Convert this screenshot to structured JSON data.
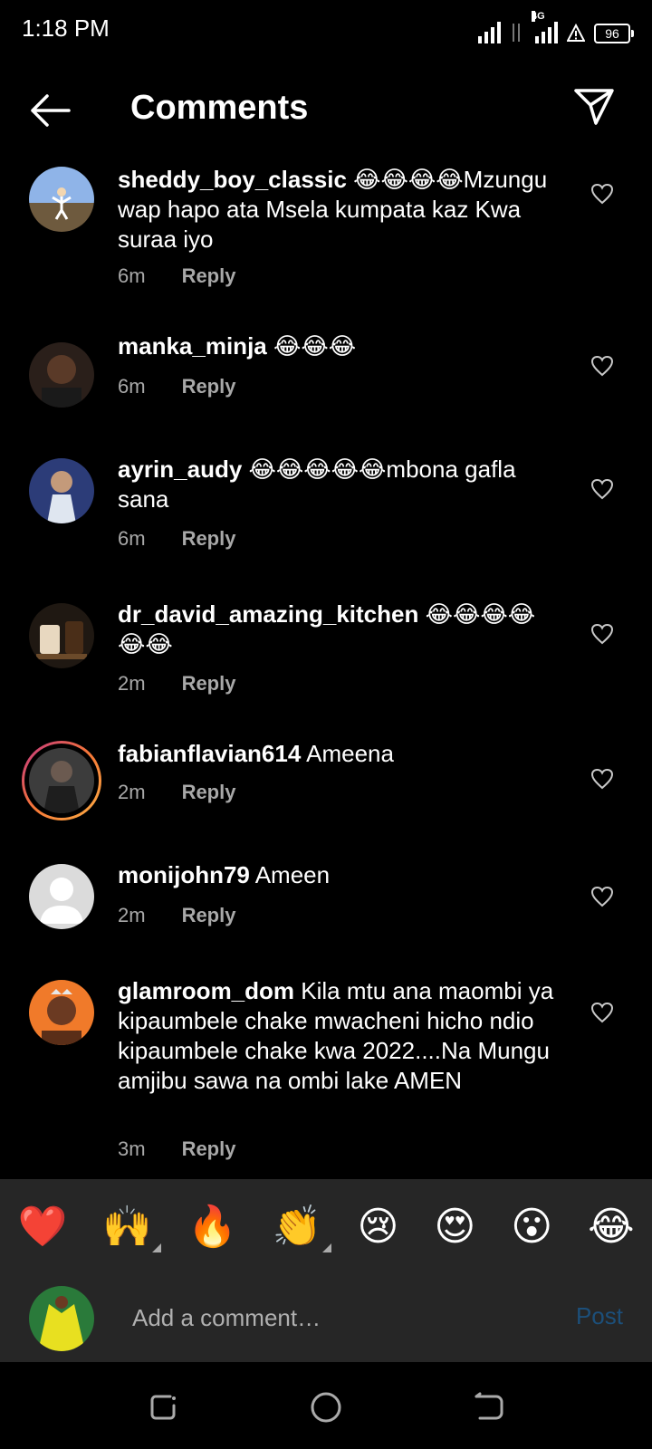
{
  "status_bar": {
    "time": "1:18 PM",
    "network_label": "4G",
    "battery": "96"
  },
  "header": {
    "title": "Comments"
  },
  "comments": [
    {
      "username": "sheddy_boy_classic",
      "text": "😂😂😂😂Mzungu wap hapo ata Msela kumpata kaz Kwa suraa iyo",
      "time": "6m",
      "reply": "Reply",
      "avatar_color": "#6b8bbf"
    },
    {
      "username": "manka_minja",
      "text": "😂😂😂",
      "time": "6m",
      "reply": "Reply",
      "avatar_color": "#5a3a2a"
    },
    {
      "username": "ayrin_audy",
      "text": "😂😂😂😂😂mbona  gafla sana",
      "time": "6m",
      "reply": "Reply",
      "avatar_color": "#3b4a7a"
    },
    {
      "username": "dr_david_amazing_kitchen",
      "text": "😂😂😂😂😂😂",
      "time": "2m",
      "reply": "Reply",
      "avatar_color": "#6b4a2a"
    },
    {
      "username": "fabianflavian614",
      "text": "Ameena",
      "time": "2m",
      "reply": "Reply",
      "avatar_color": "#3a3a3a"
    },
    {
      "username": "monijohn79",
      "text": "Ameen",
      "time": "2m",
      "reply": "Reply",
      "avatar_color": "#dbdbdb"
    },
    {
      "username": "glamroom_dom",
      "text": "Kila mtu ana maombi ya kipaumbele  chake mwacheni hicho ndio kipaumbele chake kwa 2022....Na Mungu amjibu sawa na ombi lake AMEN",
      "time": "3m",
      "reply": "Reply",
      "avatar_color": "#f07a2a"
    }
  ],
  "emoji_bar": [
    "❤️",
    "🙌",
    "🔥",
    "👏",
    "😢",
    "😍",
    "😮",
    "😂"
  ],
  "add_comment": {
    "placeholder": "Add a comment…",
    "post_label": "Post"
  },
  "colors": {
    "background": "#000000",
    "panel": "#262626",
    "meta_text": "#a8a8a8",
    "post_disabled": "#1c4f7a"
  }
}
